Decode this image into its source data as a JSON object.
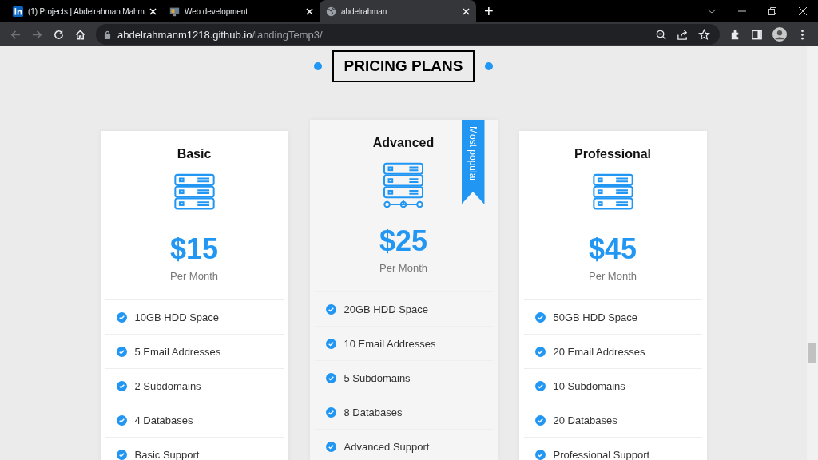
{
  "browser": {
    "tabs": [
      {
        "title": "(1) Projects | Abdelrahman Mahm",
        "kind": "linkedin",
        "selected": false
      },
      {
        "title": "Web development",
        "kind": "thumb",
        "selected": false
      },
      {
        "title": "abdelrahman",
        "kind": "globe",
        "selected": true
      }
    ],
    "new_tab": "+",
    "url": {
      "host": "abdelrahmanm1218.github.io",
      "path": "/landingTemp3/"
    }
  },
  "section": {
    "title": "PRICING PLANS"
  },
  "plans": [
    {
      "name": "Basic",
      "kind": "server",
      "price": "$15",
      "period": "Per Month",
      "featured": false,
      "features": [
        "10GB HDD Space",
        "5 Email Addresses",
        "2 Subdomains",
        "4 Databases",
        "Basic Support"
      ]
    },
    {
      "name": "Advanced",
      "kind": "network-server",
      "price": "$25",
      "period": "Per Month",
      "featured": true,
      "ribbon": "Most popular",
      "features": [
        "20GB HDD Space",
        "10 Email Addresses",
        "5 Subdomains",
        "8 Databases",
        "Advanced Support"
      ]
    },
    {
      "name": "Professional",
      "kind": "server",
      "price": "$45",
      "period": "Per Month",
      "featured": false,
      "features": [
        "50GB HDD Space",
        "20 Email Addresses",
        "10 Subdomains",
        "20 Databases",
        "Professional Support"
      ]
    }
  ]
}
